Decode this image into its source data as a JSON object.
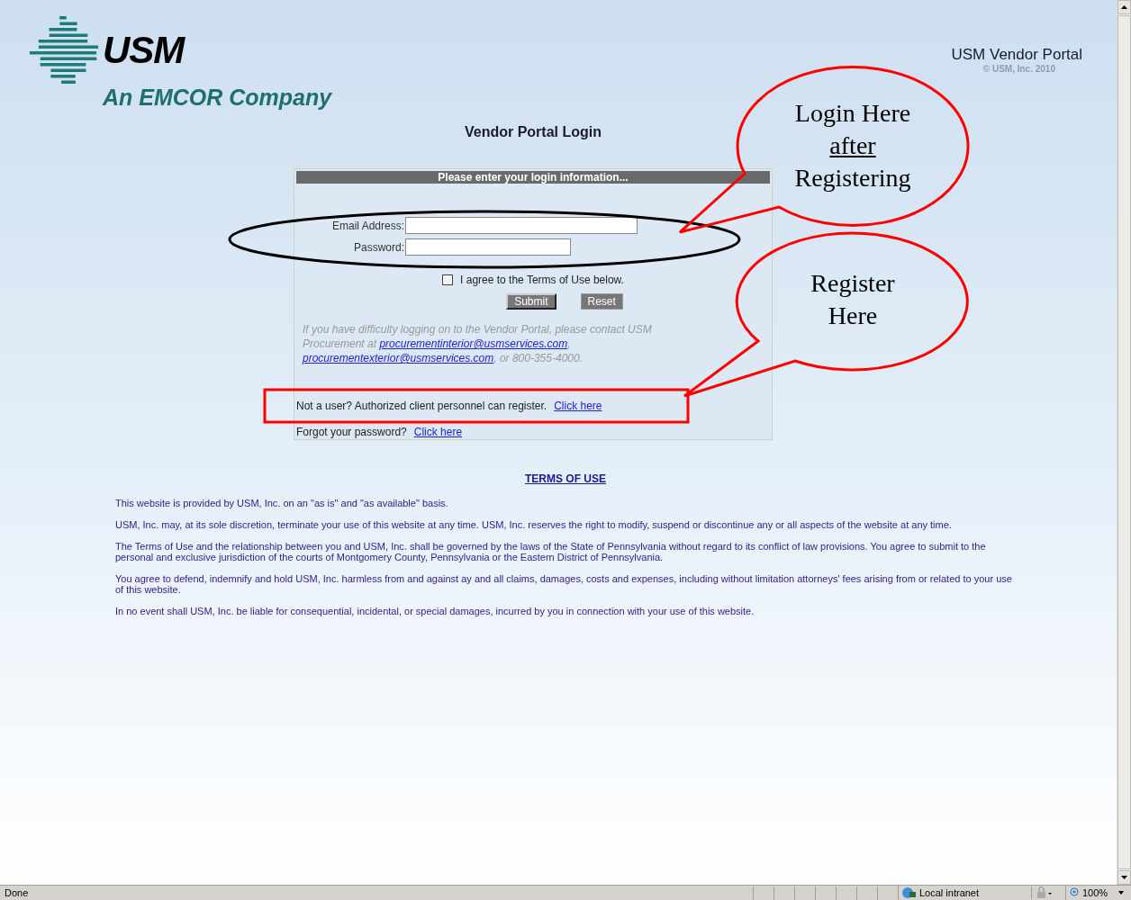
{
  "header": {
    "logo_text": "USM",
    "tagline": "An EMCOR Company",
    "portal_title": "USM Vendor Portal",
    "copyright": "© USM, Inc. 2010"
  },
  "login": {
    "title": "Vendor Portal Login",
    "panel_heading": "Please enter your login information...",
    "fields": [
      {
        "label": "Email Address:"
      },
      {
        "label": "Password:"
      }
    ],
    "agree": {
      "label": "I agree to the Terms of Use below.",
      "checked": false
    },
    "buttons": [
      "Submit",
      "Reset"
    ],
    "help": {
      "text_before": "If you have difficulty logging on to the Vendor Portal, please contact USM Procurement at ",
      "links": [
        "procurementinterior@usmservices.com",
        "procurementexterior@usmservices.com"
      ],
      "separator": ",",
      "text_after": ", or 800-355-4000."
    },
    "register": {
      "text": "Not a user? Authorized client personnel can register.",
      "link": "Click here"
    },
    "forgot": {
      "text": "Forgot your password?",
      "link": "Click here"
    }
  },
  "terms": {
    "heading": "TERMS OF USE",
    "paragraphs": [
      "This website is provided by USM, Inc. on an \"as is\" and \"as available\" basis.",
      "USM, Inc. may, at its sole discretion, terminate your use of this website at any time. USM, Inc. reserves the right to modify, suspend or discontinue any or all aspects of the website at any time.",
      "The Terms of Use and the relationship between you and USM, Inc. shall be governed by the laws of the State of Pennsylvania without regard to its conflict of law provisions. You agree to submit to the personal and exclusive jurisdiction of the courts of Montgomery County, Pennsylvania or the Eastern District of Pennsylvania.",
      "You agree to defend, indemnify and hold USM, Inc. harmless from and against ay and all claims, damages, costs and expenses, including without limitation attorneys' fees arising from or related to your use of this website.",
      "In no event shall USM, Inc. be liable for consequential, incidental, or special damages, incurred by you in connection with your use of this website."
    ]
  },
  "annotations": [
    {
      "kind": "ellipse"
    },
    {
      "kind": "rectangle"
    },
    {
      "kind": "callout",
      "lines": [
        {
          "text": "Login Here",
          "underlined": false
        },
        {
          "text": "after",
          "underlined": true
        },
        {
          "text": "Registering",
          "underlined": false
        }
      ]
    },
    {
      "kind": "callout",
      "lines": [
        {
          "text": "Register",
          "underlined": false
        },
        {
          "text": "Here",
          "underlined": false
        }
      ]
    }
  ],
  "status_bar": {
    "status": "Done",
    "zone": "Local intranet",
    "zoom": "100%"
  }
}
